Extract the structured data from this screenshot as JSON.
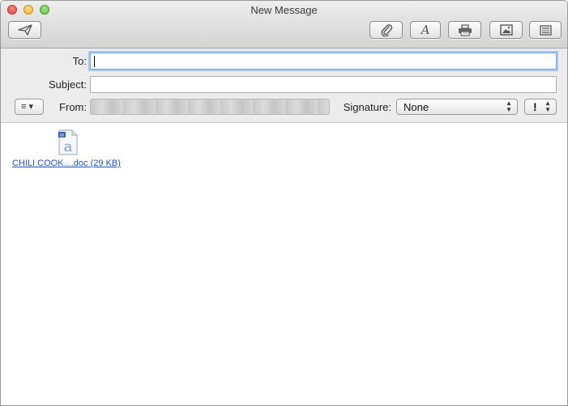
{
  "window": {
    "title": "New Message"
  },
  "toolbar": {
    "send_icon": "paper-plane-icon",
    "attach_icon": "paperclip-icon",
    "fonts_icon": "font-A-icon",
    "fonts_glyph": "A",
    "print_icon": "printer-icon",
    "photo_icon": "photo-browser-icon",
    "template_icon": "stationery-icon"
  },
  "headers": {
    "to_label": "To:",
    "to_value": "",
    "subject_label": "Subject:",
    "subject_value": "",
    "from_label": "From:",
    "signature_label": "Signature:",
    "signature_value": "None",
    "priority_glyph": "!",
    "header_menu_glyph": "≡ ▾"
  },
  "attachment": {
    "label": "CHILI COOK....doc (29 KB)",
    "icon": "word-document-icon"
  },
  "colors": {
    "link": "#1d56c8",
    "focus_ring": "#a9c8f0",
    "close": "#e0443e",
    "minimize": "#f0b028",
    "maximize": "#5dbb3a"
  }
}
